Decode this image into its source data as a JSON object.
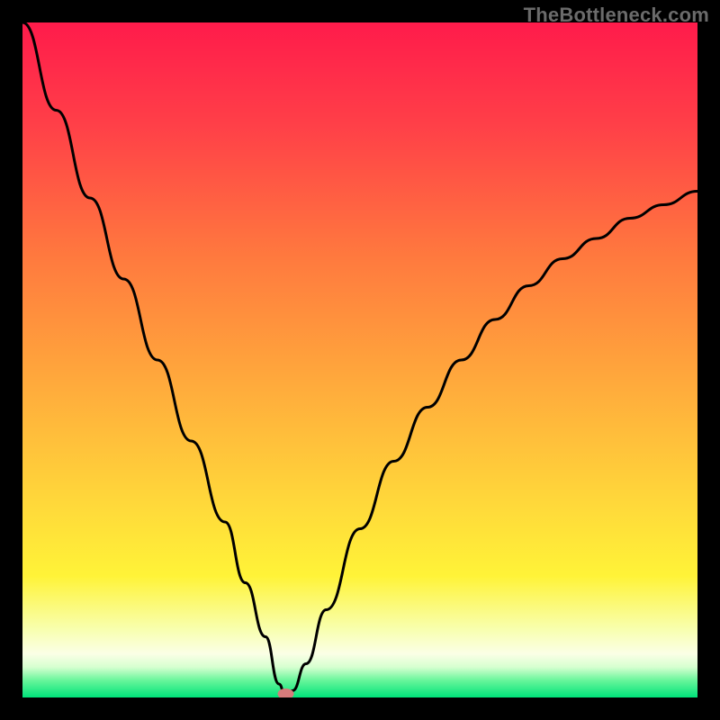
{
  "source_label": "TheBottleneck.com",
  "colors": {
    "frame": "#000000",
    "curve": "#000000",
    "marker": "#d77b7b",
    "gradient_stops": [
      {
        "offset": 0.0,
        "color": "#ff1b4b"
      },
      {
        "offset": 0.15,
        "color": "#ff3f48"
      },
      {
        "offset": 0.35,
        "color": "#ff7a3e"
      },
      {
        "offset": 0.52,
        "color": "#ffa63c"
      },
      {
        "offset": 0.7,
        "color": "#ffd53a"
      },
      {
        "offset": 0.82,
        "color": "#fff338"
      },
      {
        "offset": 0.9,
        "color": "#f8ffb0"
      },
      {
        "offset": 0.935,
        "color": "#fbffe6"
      },
      {
        "offset": 0.955,
        "color": "#d6ffd0"
      },
      {
        "offset": 0.975,
        "color": "#66f59a"
      },
      {
        "offset": 1.0,
        "color": "#00e37a"
      }
    ]
  },
  "chart_data": {
    "type": "line",
    "title": "",
    "xlabel": "",
    "ylabel": "",
    "xlim": [
      0,
      100
    ],
    "ylim": [
      0,
      100
    ],
    "grid": false,
    "legend": false,
    "minimum_marker": {
      "x": 39,
      "y": 0
    },
    "series": [
      {
        "name": "bottleneck-curve",
        "x": [
          0,
          5,
          10,
          15,
          20,
          25,
          30,
          33,
          36,
          38,
          39,
          40,
          42,
          45,
          50,
          55,
          60,
          65,
          70,
          75,
          80,
          85,
          90,
          95,
          100
        ],
        "y": [
          100,
          87,
          74,
          62,
          50,
          38,
          26,
          17,
          9,
          2,
          0,
          1,
          5,
          13,
          25,
          35,
          43,
          50,
          56,
          61,
          65,
          68,
          71,
          73,
          75
        ]
      }
    ]
  }
}
